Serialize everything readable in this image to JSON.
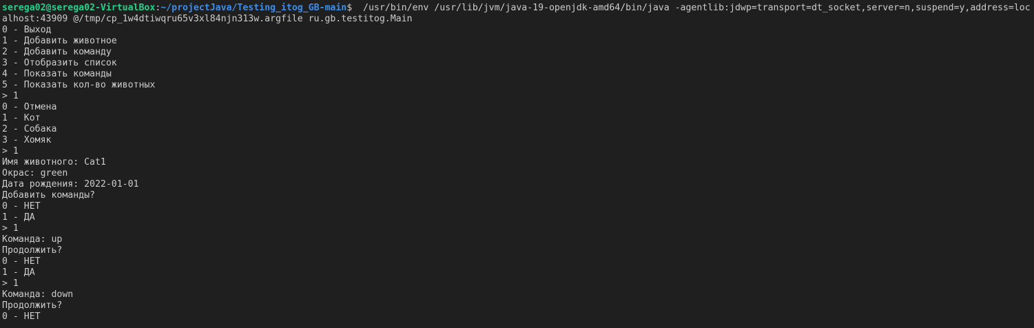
{
  "prompt": {
    "user_host": "serega02@serega02-VirtualBox",
    "separator": ":",
    "path": "~/projectJava/Testing_itog_GB-main",
    "symbol": "$",
    "command": "  /usr/bin/env /usr/lib/jvm/java-19-openjdk-amd64/bin/java -agentlib:jdwp=transport=dt_socket,server=n,suspend=y,address=loc"
  },
  "lines": [
    "alhost:43909 @/tmp/cp_1w4dtiwqru65v3xl84njn313w.argfile ru.gb.testitog.Main",
    "0 - Выход",
    "1 - Добавить животное",
    "2 - Добавить команду",
    "3 - Отобразить список",
    "4 - Показать команды",
    "5 - Показать кол-во животных",
    "> 1",
    "0 - Отмена",
    "1 - Кот",
    "2 - Собака",
    "3 - Хомяк",
    "> 1",
    "Имя животного: Cat1",
    "Окрас: green",
    "Дата рождения: 2022-01-01",
    "Добавить команды?",
    "0 - НЕТ",
    "1 - ДА",
    "> 1",
    "Команда: up",
    "Продолжить?",
    "0 - НЕТ",
    "1 - ДА",
    "> 1",
    "Команда: down",
    "Продолжить?",
    "0 - НЕТ"
  ],
  "colors": {
    "background": "#1f1f1f",
    "text": "#cccccc",
    "user_host": "#23d18b",
    "path": "#3b8eea"
  }
}
